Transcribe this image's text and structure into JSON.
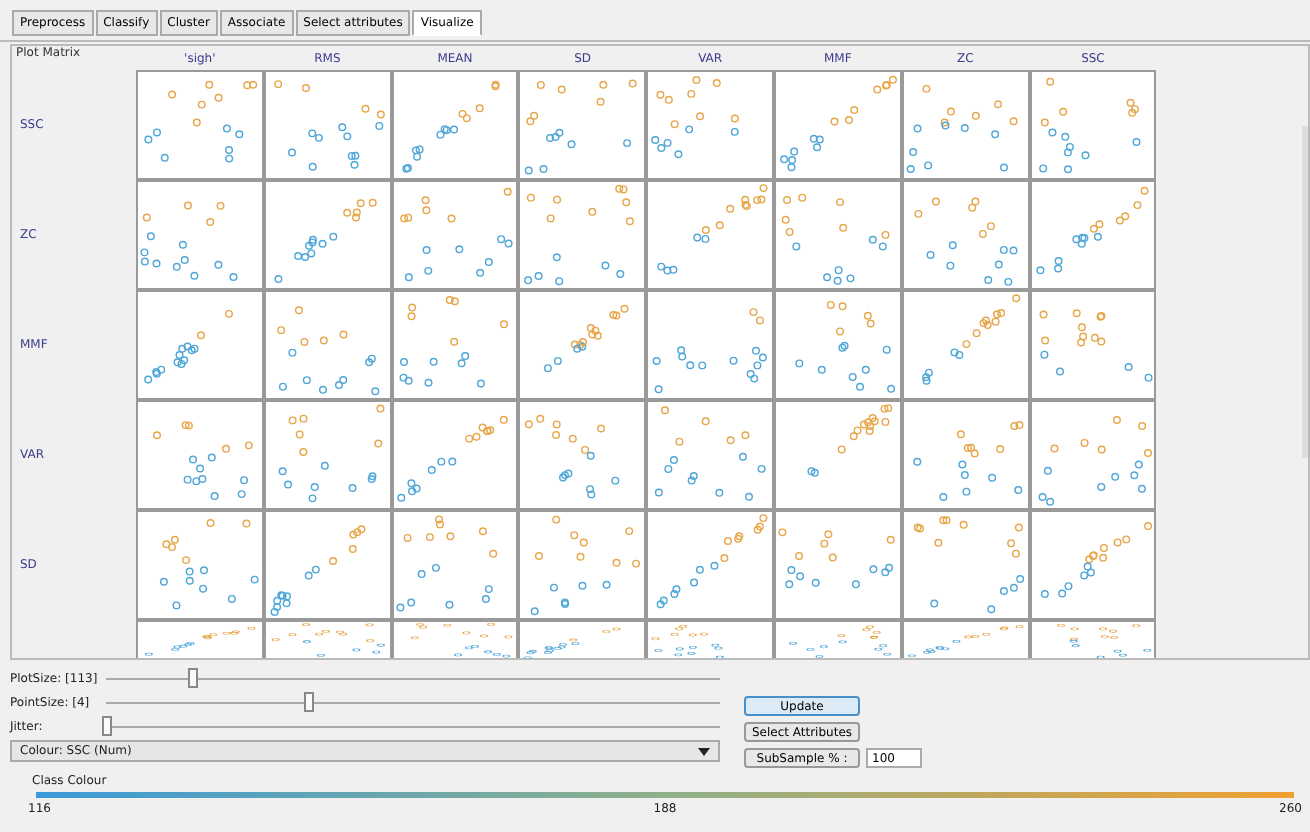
{
  "tabs": [
    {
      "label": "Preprocess",
      "selected": false
    },
    {
      "label": "Classify",
      "selected": false
    },
    {
      "label": "Cluster",
      "selected": false
    },
    {
      "label": "Associate",
      "selected": false
    },
    {
      "label": "Select attributes",
      "selected": false
    },
    {
      "label": "Visualize",
      "selected": true
    }
  ],
  "plot_matrix": {
    "title": "Plot Matrix",
    "columns": [
      "'sigh'",
      "RMS",
      "MEAN",
      "SD",
      "VAR",
      "MMF",
      "ZC",
      "SSC"
    ],
    "rows": [
      "SSC",
      "ZC",
      "MMF",
      "VAR",
      "SD"
    ]
  },
  "sliders": [
    {
      "label": "PlotSize: [113]",
      "level": 0.14
    },
    {
      "label": "PointSize: [4]",
      "level": 0.33
    },
    {
      "label": "Jitter:",
      "level": 0.0
    }
  ],
  "colour_select": {
    "value": "Colour: SSC (Num)"
  },
  "buttons": [
    {
      "label": "Update",
      "focused": true
    },
    {
      "label": "Select Attributes",
      "focused": false
    }
  ],
  "subsample": {
    "label": "SubSample % :",
    "value": "100"
  },
  "class_colour": {
    "title": "Class Colour",
    "ticks": [
      "116",
      "188",
      "260"
    ]
  }
}
